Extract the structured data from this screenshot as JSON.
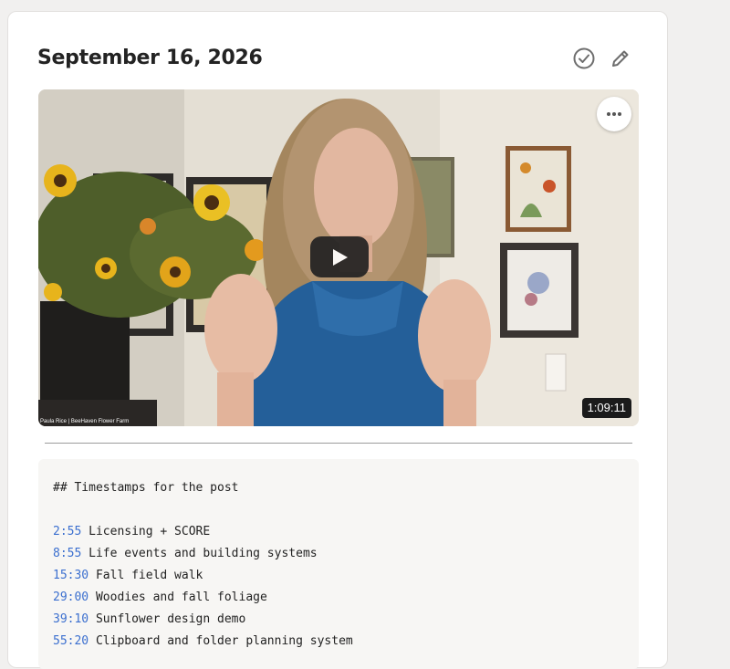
{
  "post": {
    "date": "September 16, 2026"
  },
  "icons": {
    "check": "check-circle-icon",
    "edit": "pencil-icon",
    "more": "more-horizontal-icon",
    "play": "play-icon"
  },
  "video": {
    "duration": "1:09:11",
    "caption": "Paula Rice | BeeHaven Flower Farm"
  },
  "notes": {
    "heading": "## Timestamps for the post",
    "items": [
      {
        "time": "2:55",
        "label": "Licensing + SCORE"
      },
      {
        "time": "8:55",
        "label": "Life events and building systems"
      },
      {
        "time": "15:30",
        "label": "Fall field walk"
      },
      {
        "time": "29:00",
        "label": "Woodies and fall foliage"
      },
      {
        "time": "39:10",
        "label": "Sunflower design demo"
      },
      {
        "time": "55:20",
        "label": "Clipboard and folder planning system"
      }
    ]
  },
  "colors": {
    "accent_link": "#3b6fcf",
    "play_button": "#222222"
  }
}
